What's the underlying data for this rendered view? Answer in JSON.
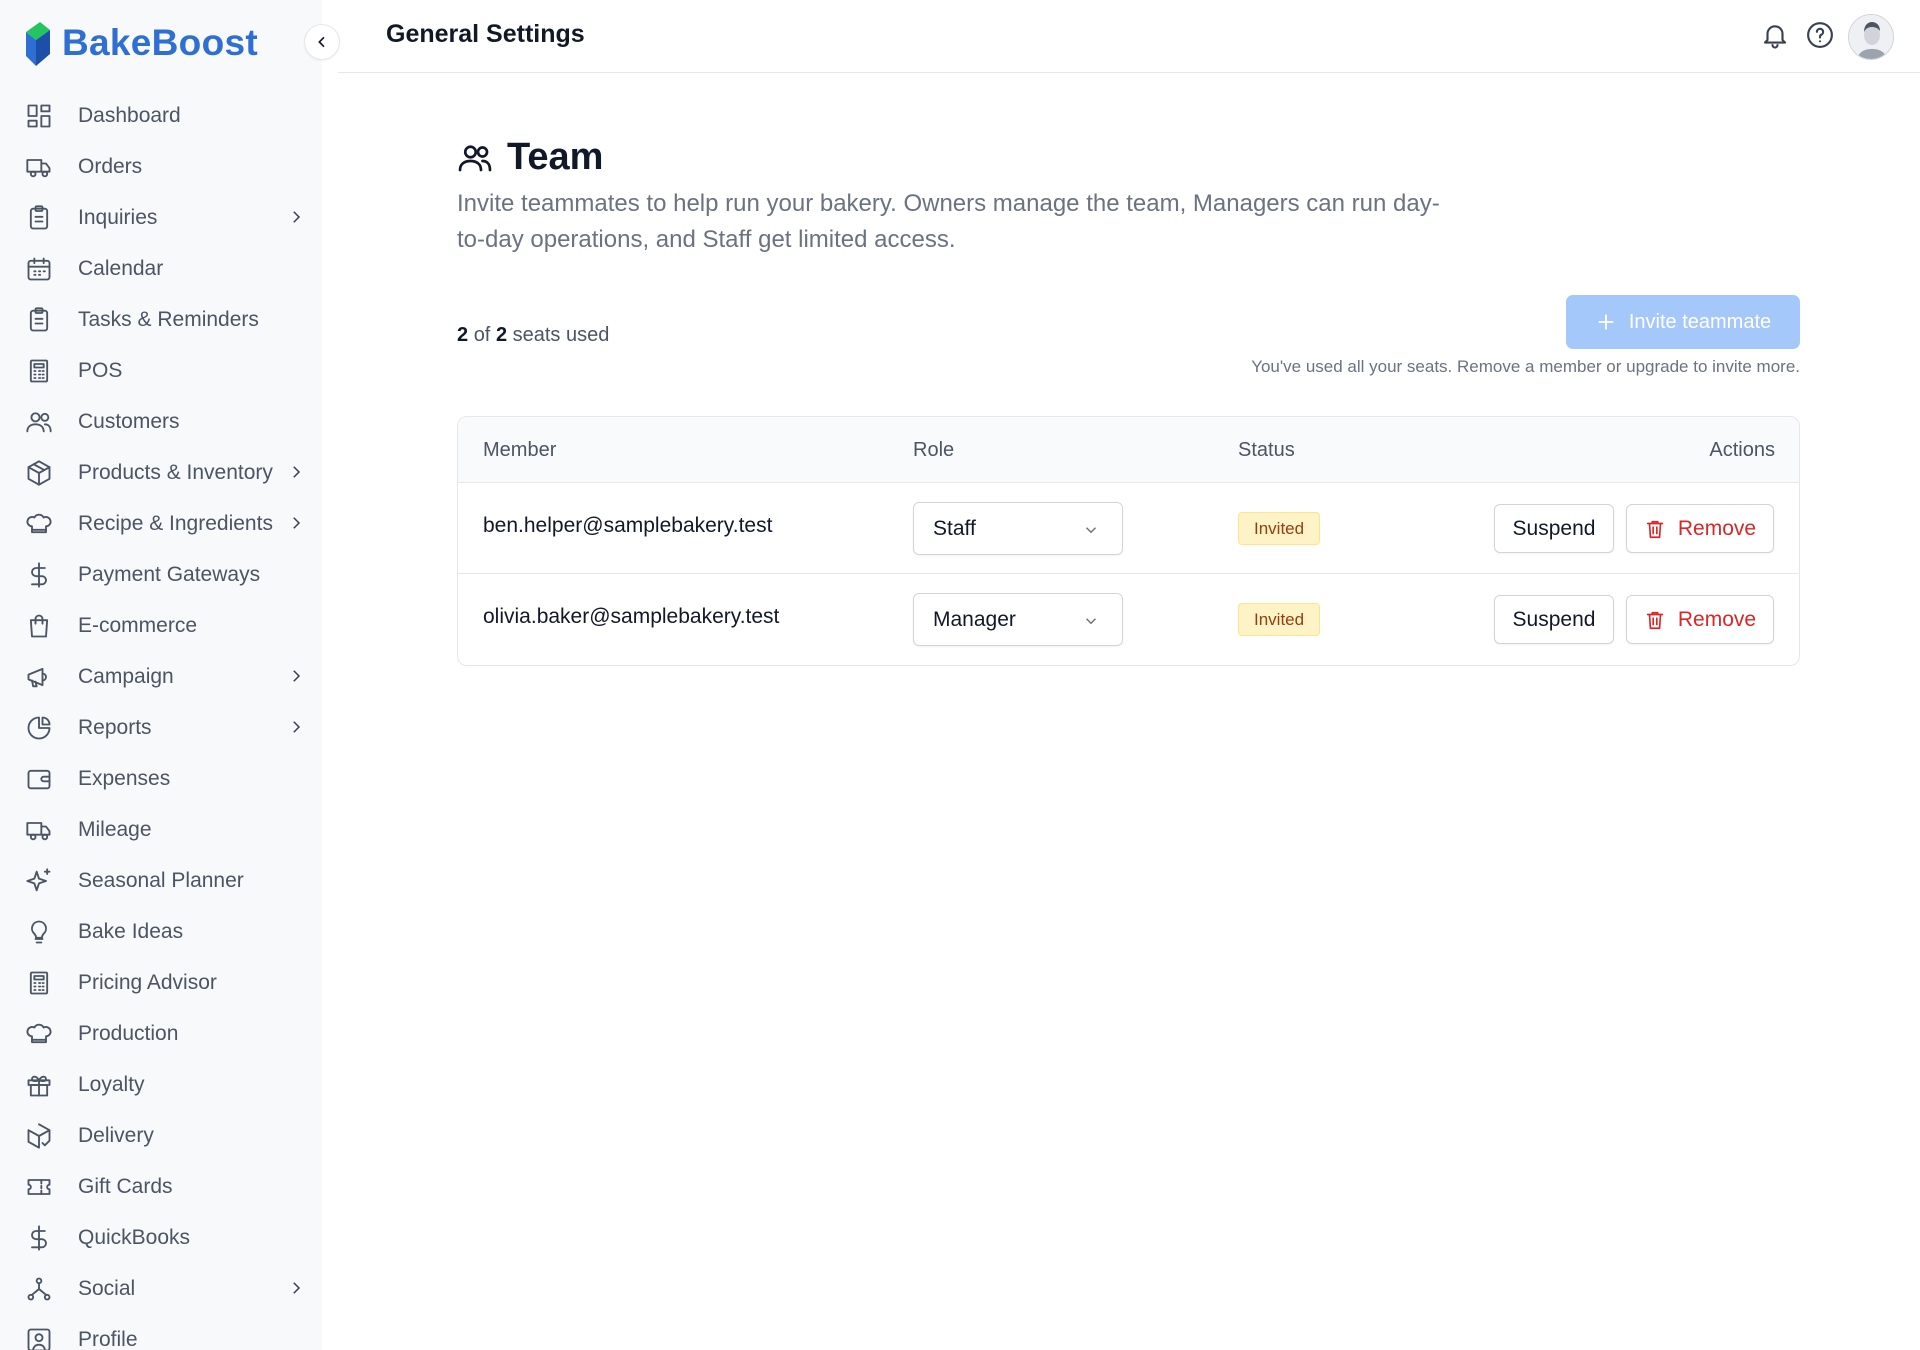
{
  "brand": {
    "name": "BakeBoost",
    "color": "#2f6fd1"
  },
  "sidebar": {
    "items": [
      {
        "label": "Dashboard",
        "icon": "dashboard-icon",
        "chevron": false
      },
      {
        "label": "Orders",
        "icon": "truck-icon",
        "chevron": false
      },
      {
        "label": "Inquiries",
        "icon": "clipboard-icon",
        "chevron": true
      },
      {
        "label": "Calendar",
        "icon": "calendar-icon",
        "chevron": false
      },
      {
        "label": "Tasks & Reminders",
        "icon": "clipboard-list-icon",
        "chevron": false
      },
      {
        "label": "POS",
        "icon": "calculator-icon",
        "chevron": false
      },
      {
        "label": "Customers",
        "icon": "users-icon",
        "chevron": false
      },
      {
        "label": "Products & Inventory",
        "icon": "box-icon",
        "chevron": true
      },
      {
        "label": "Recipe & Ingredients",
        "icon": "chef-hat-icon",
        "chevron": true
      },
      {
        "label": "Payment Gateways",
        "icon": "dollar-icon",
        "chevron": false
      },
      {
        "label": "E-commerce",
        "icon": "shopping-bag-icon",
        "chevron": false
      },
      {
        "label": "Campaign",
        "icon": "megaphone-icon",
        "chevron": true
      },
      {
        "label": "Reports",
        "icon": "pie-chart-icon",
        "chevron": true
      },
      {
        "label": "Expenses",
        "icon": "wallet-icon",
        "chevron": false
      },
      {
        "label": "Mileage",
        "icon": "truck-icon",
        "chevron": false
      },
      {
        "label": "Seasonal Planner",
        "icon": "sparkles-icon",
        "chevron": false
      },
      {
        "label": "Bake Ideas",
        "icon": "lightbulb-icon",
        "chevron": false
      },
      {
        "label": "Pricing Advisor",
        "icon": "calculator-icon",
        "chevron": false
      },
      {
        "label": "Production",
        "icon": "chef-hat-icon",
        "chevron": false
      },
      {
        "label": "Loyalty",
        "icon": "gift-icon",
        "chevron": false
      },
      {
        "label": "Delivery",
        "icon": "package-check-icon",
        "chevron": false
      },
      {
        "label": "Gift Cards",
        "icon": "ticket-icon",
        "chevron": false
      },
      {
        "label": "QuickBooks",
        "icon": "dollar-icon",
        "chevron": false
      },
      {
        "label": "Social",
        "icon": "share-nodes-icon",
        "chevron": true
      },
      {
        "label": "Profile",
        "icon": "profile-icon",
        "chevron": false
      }
    ]
  },
  "header": {
    "title": "General Settings"
  },
  "team": {
    "title": "Team",
    "description": "Invite teammates to help run your bakery. Owners manage the team, Managers can run day-to-day operations, and Staff get limited access.",
    "seats_used": "2",
    "seats_of": "of",
    "seats_total": "2",
    "seats_suffix": "seats used",
    "invite_label": "Invite teammate",
    "seat_note": "You've used all your seats. Remove a member or upgrade to invite more."
  },
  "table": {
    "headers": {
      "member": "Member",
      "role": "Role",
      "status": "Status",
      "actions": "Actions"
    },
    "rows": [
      {
        "email": "ben.helper@samplebakery.test",
        "role": "Staff",
        "status": "Invited",
        "suspend": "Suspend",
        "remove": "Remove"
      },
      {
        "email": "olivia.baker@samplebakery.test",
        "role": "Manager",
        "status": "Invited",
        "suspend": "Suspend",
        "remove": "Remove"
      }
    ]
  },
  "colors": {
    "accent": "#2f6fd1",
    "invite_disabled": "#a5c8fb",
    "danger": "#dc2626",
    "badge_bg": "#fef3c7"
  }
}
